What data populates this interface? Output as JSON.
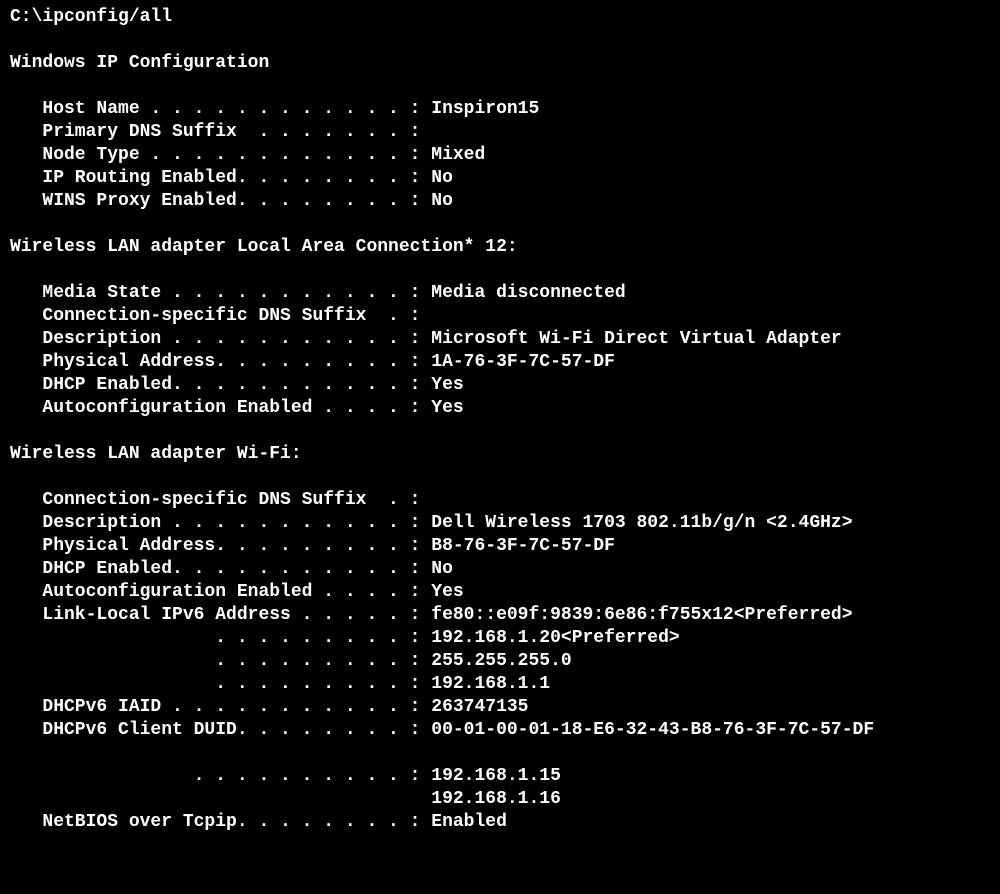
{
  "prompt": "C:\\ipconfig/all",
  "blank": "",
  "header": "Windows IP Configuration",
  "ipcfg": {
    "host_name": "   Host Name . . . . . . . . . . . . : Inspiron15",
    "primary_dns_suffix": "   Primary DNS Suffix  . . . . . . . :",
    "node_type": "   Node Type . . . . . . . . . . . . : Mixed",
    "ip_routing_enabled": "   IP Routing Enabled. . . . . . . . : No",
    "wins_proxy_enabled": "   WINS Proxy Enabled. . . . . . . . : No"
  },
  "adapter1_header": "Wireless LAN adapter Local Area Connection* 12:",
  "adapter1": {
    "media_state": "   Media State . . . . . . . . . . . : Media disconnected",
    "conn_dns_suffix": "   Connection-specific DNS Suffix  . :",
    "description": "   Description . . . . . . . . . . . : Microsoft Wi-Fi Direct Virtual Adapter",
    "physical_address": "   Physical Address. . . . . . . . . : 1A-76-3F-7C-57-DF",
    "dhcp_enabled": "   DHCP Enabled. . . . . . . . . . . : Yes",
    "autoconfig_enabled": "   Autoconfiguration Enabled . . . . : Yes"
  },
  "adapter2_header": "Wireless LAN adapter Wi-Fi:",
  "adapter2": {
    "conn_dns_suffix": "   Connection-specific DNS Suffix  . :",
    "description": "   Description . . . . . . . . . . . : Dell Wireless 1703 802.11b/g/n <2.4GHz>",
    "physical_address": "   Physical Address. . . . . . . . . : B8-76-3F-7C-57-DF",
    "dhcp_enabled": "   DHCP Enabled. . . . . . . . . . . : No",
    "autoconfig_enabled": "   Autoconfiguration Enabled . . . . : Yes",
    "link_local_ipv6": "   Link-Local IPv6 Address . . . . . : fe80::e09f:9839:6e86:f755x12<Preferred>",
    "ipv4_address": "                   . . . . . . . . . : 192.168.1.20<Preferred>",
    "subnet_mask": "                   . . . . . . . . . : 255.255.255.0",
    "default_gateway": "                   . . . . . . . . . : 192.168.1.1",
    "dhcpv6_iaid": "   DHCPv6 IAID . . . . . . . . . . . : 263747135",
    "dhcpv6_client_duid": "   DHCPv6 Client DUID. . . . . . . . : 00-01-00-01-18-E6-32-43-B8-76-3F-7C-57-DF",
    "dns_servers_1": "                 . . . . . . . . . . : 192.168.1.15",
    "dns_servers_2": "                                       192.168.1.16",
    "netbios_over_tcpip": "   NetBIOS over Tcpip. . . . . . . . : Enabled"
  }
}
